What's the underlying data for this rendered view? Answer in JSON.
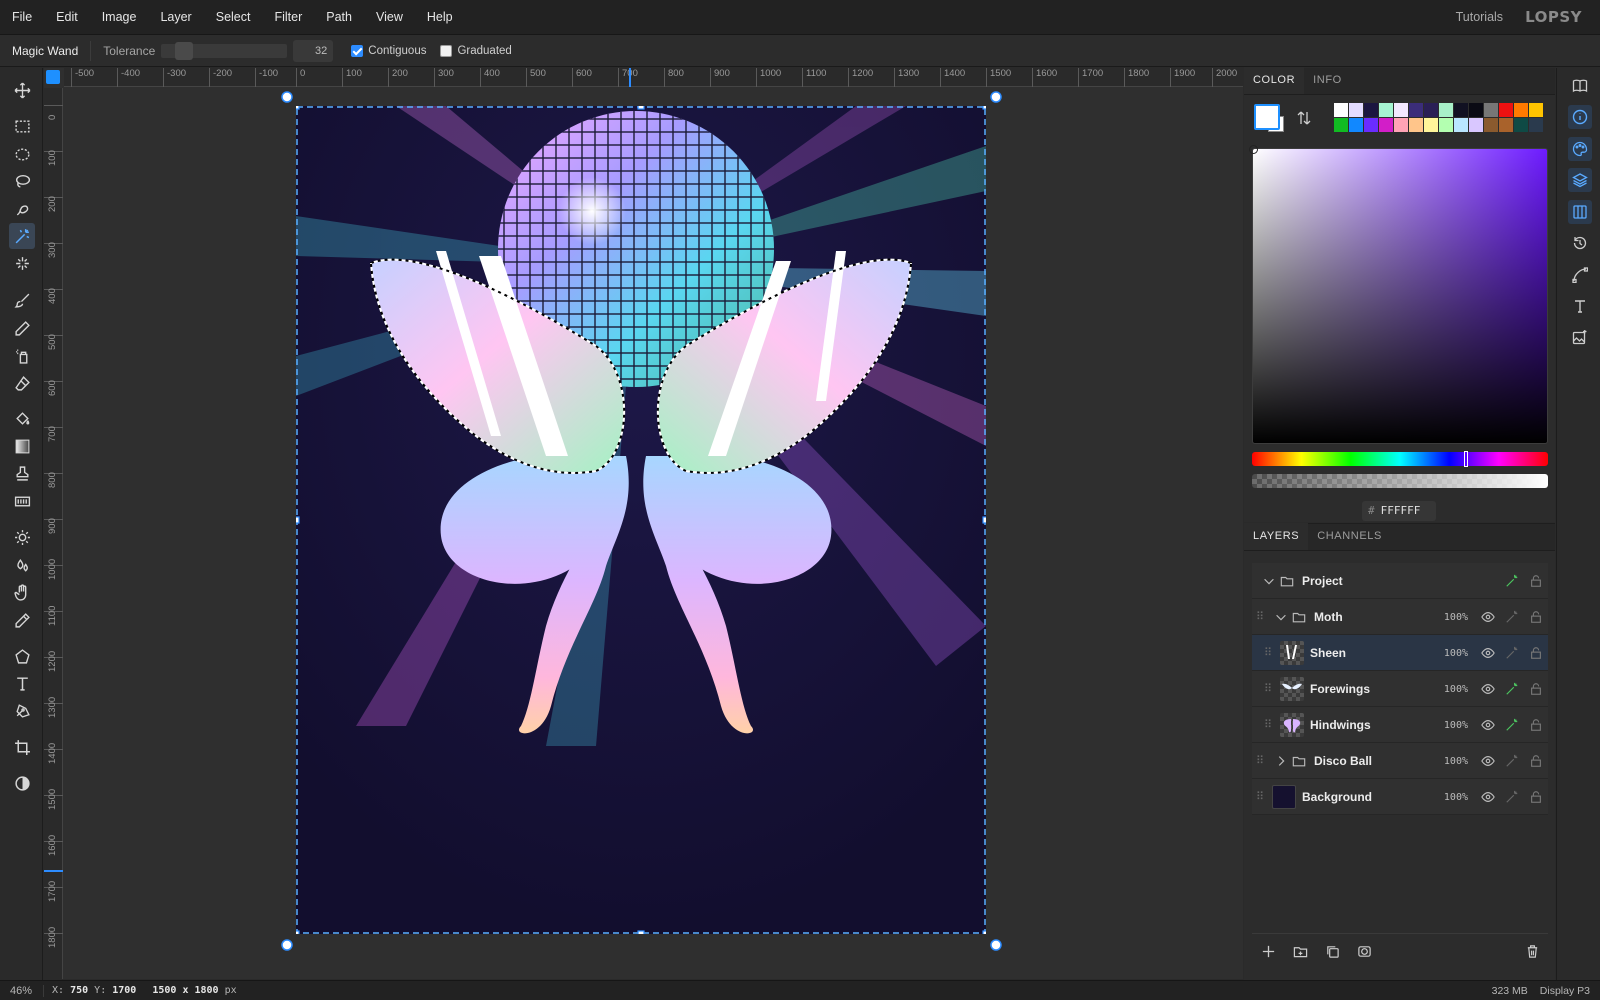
{
  "menubar": {
    "items": [
      "File",
      "Edit",
      "Image",
      "Layer",
      "Select",
      "Filter",
      "Path",
      "View",
      "Help"
    ],
    "tutorials": "Tutorials",
    "logo": "LOPSY"
  },
  "options": {
    "tool_name": "Magic Wand",
    "tolerance_label": "Tolerance",
    "tolerance_value": "32",
    "contiguous_label": "Contiguous",
    "contiguous_checked": true,
    "graduated_label": "Graduated",
    "graduated_checked": false
  },
  "tools": [
    {
      "name": "move-tool",
      "icon": "move-icon"
    },
    {
      "name": "rect-select-tool",
      "icon": "rectangle-select-icon"
    },
    {
      "name": "ellipse-select-tool",
      "icon": "ellipse-select-icon"
    },
    {
      "name": "lasso-tool",
      "icon": "lasso-icon"
    },
    {
      "name": "quick-select-tool",
      "icon": "quick-select-icon"
    },
    {
      "name": "magic-wand-tool",
      "icon": "magic-wand-icon",
      "active": true
    },
    {
      "name": "object-select-tool",
      "icon": "sparkle-select-icon"
    },
    {
      "name": "brush-tool",
      "icon": "brush-icon"
    },
    {
      "name": "pencil-tool",
      "icon": "pencil-icon"
    },
    {
      "name": "spray-tool",
      "icon": "spray-icon"
    },
    {
      "name": "eraser-tool",
      "icon": "eraser-icon"
    },
    {
      "name": "bucket-tool",
      "icon": "paint-bucket-icon"
    },
    {
      "name": "gradient-tool",
      "icon": "gradient-icon"
    },
    {
      "name": "stamp-tool",
      "icon": "clone-stamp-icon"
    },
    {
      "name": "pattern-tool",
      "icon": "pattern-icon"
    },
    {
      "name": "dodge-tool",
      "icon": "sun-icon"
    },
    {
      "name": "blur-tool",
      "icon": "drops-icon"
    },
    {
      "name": "hand-tool",
      "icon": "hand-icon"
    },
    {
      "name": "eyedropper-tool",
      "icon": "eyedropper-icon"
    },
    {
      "name": "shape-tool",
      "icon": "pentagon-icon"
    },
    {
      "name": "text-tool",
      "icon": "text-icon"
    },
    {
      "name": "pen-tool",
      "icon": "pen-icon"
    },
    {
      "name": "crop-tool",
      "icon": "crop-icon"
    },
    {
      "name": "mask-mode-tool",
      "icon": "half-circle-icon"
    }
  ],
  "rulers": {
    "h_labels": [
      "-500",
      "-400",
      "-300",
      "-200",
      "-100",
      "0",
      "100",
      "200",
      "300",
      "400",
      "500",
      "600",
      "700",
      "800",
      "900",
      "1000",
      "1100",
      "1200",
      "1300",
      "1400",
      "1500",
      "1600",
      "1700",
      "1800",
      "1900",
      "2000"
    ],
    "v_labels": [
      "0",
      "100",
      "200",
      "300",
      "400",
      "500",
      "600",
      "700",
      "800",
      "900",
      "1000",
      "1100",
      "1200",
      "1300",
      "1400",
      "1500",
      "1600",
      "1700",
      "1800"
    ]
  },
  "color_panel": {
    "tabs": [
      "COLOR",
      "INFO"
    ],
    "foreground": "#FFFFFF",
    "background": "#FFFFFF",
    "hex_value": "FFFFFF",
    "hex_prefix": "#",
    "swatches": [
      "#ffffff",
      "#e4dcff",
      "#1b1640",
      "#a6f5d2",
      "#f3e8ff",
      "#3b2d7a",
      "#2a1f55",
      "#a8f0c8",
      "#111122",
      "#0a0a14",
      "#777777",
      "#ee1111",
      "#ff7a00",
      "#ffc400",
      "#11bb22",
      "#1188ff",
      "#6a2cff",
      "#d21ec8",
      "#ffa3b5",
      "#ffc58a",
      "#fff59a",
      "#b3ffb0",
      "#b9e6ff",
      "#d9c7ff",
      "#8a5a2e",
      "#a9622b",
      "#0f4a45",
      "#2a3a4d"
    ]
  },
  "layers_panel": {
    "tabs": [
      "LAYERS",
      "CHANNELS"
    ],
    "layers": [
      {
        "name": "Project",
        "type": "group",
        "opacity": "",
        "depth": 0,
        "expanded": true
      },
      {
        "name": "Moth",
        "type": "group",
        "opacity": "100%",
        "depth": 1,
        "expanded": true
      },
      {
        "name": "Sheen",
        "type": "layer",
        "opacity": "100%",
        "depth": 2,
        "selected": true
      },
      {
        "name": "Forewings",
        "type": "layer",
        "opacity": "100%",
        "depth": 2
      },
      {
        "name": "Hindwings",
        "type": "layer",
        "opacity": "100%",
        "depth": 2
      },
      {
        "name": "Disco Ball",
        "type": "group",
        "opacity": "100%",
        "depth": 1,
        "expanded": false
      },
      {
        "name": "Background",
        "type": "layer",
        "opacity": "100%",
        "depth": 1
      }
    ]
  },
  "status": {
    "zoom": "46%",
    "x_label": "X:",
    "x_value": "750",
    "y_label": "Y:",
    "y_value": "1700",
    "dims": "1500 x 1800",
    "dims_unit": "px",
    "memory": "323 MB",
    "color_profile": "Display P3"
  }
}
